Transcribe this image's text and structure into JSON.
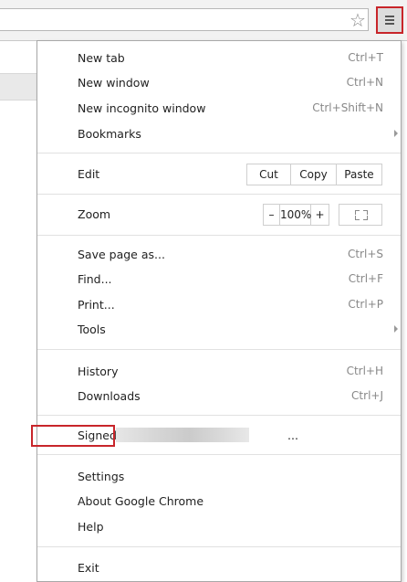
{
  "toolbar": {
    "bookmark_icon": "star-icon",
    "menu_icon": "hamburger-menu-icon"
  },
  "menu": {
    "new_tab": {
      "label": "New tab",
      "shortcut": "Ctrl+T"
    },
    "new_window": {
      "label": "New window",
      "shortcut": "Ctrl+N"
    },
    "new_incognito": {
      "label": "New incognito window",
      "shortcut": "Ctrl+Shift+N"
    },
    "bookmarks": {
      "label": "Bookmarks"
    },
    "edit": {
      "label": "Edit",
      "cut": "Cut",
      "copy": "Copy",
      "paste": "Paste"
    },
    "zoom": {
      "label": "Zoom",
      "minus": "–",
      "value": "100%",
      "plus": "+"
    },
    "save_page": {
      "label": "Save page as...",
      "shortcut": "Ctrl+S"
    },
    "find": {
      "label": "Find...",
      "shortcut": "Ctrl+F"
    },
    "print": {
      "label": "Print...",
      "shortcut": "Ctrl+P"
    },
    "tools": {
      "label": "Tools"
    },
    "history": {
      "label": "History",
      "shortcut": "Ctrl+H"
    },
    "downloads": {
      "label": "Downloads",
      "shortcut": "Ctrl+J"
    },
    "signed_in": {
      "label": "Signed in as",
      "suffix": "..."
    },
    "settings": {
      "label": "Settings"
    },
    "about": {
      "label": "About Google Chrome"
    },
    "help": {
      "label": "Help"
    },
    "exit": {
      "label": "Exit"
    }
  },
  "colors": {
    "highlight": "#c8252a",
    "shortcut_text": "#888888",
    "menu_border": "#a8a8a8"
  }
}
